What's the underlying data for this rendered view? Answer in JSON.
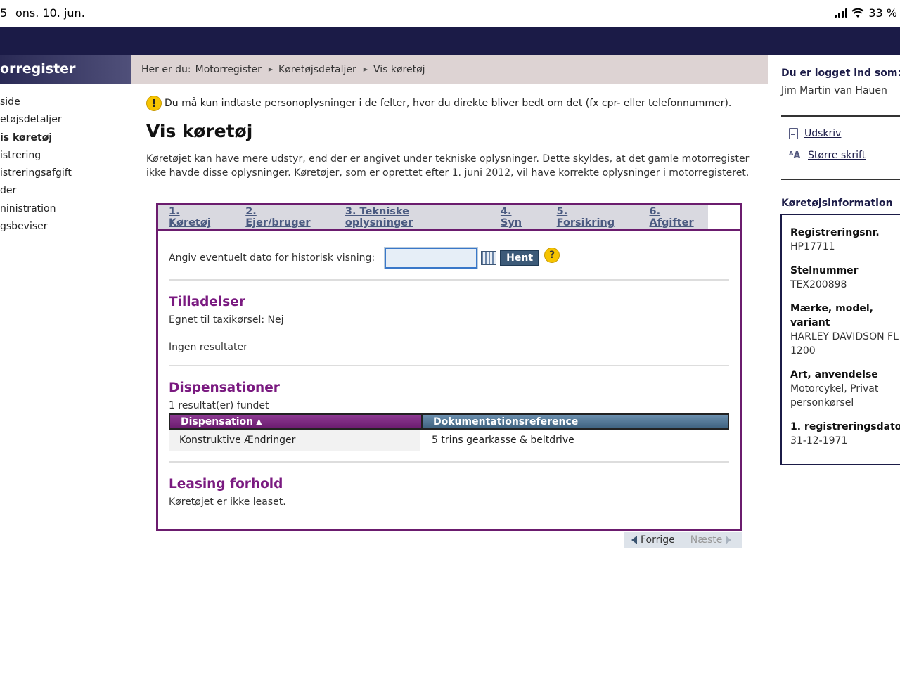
{
  "status": {
    "time": "5",
    "date": "ons. 10. jun.",
    "battery": "33 %"
  },
  "sidebar": {
    "title": "orregister",
    "items": [
      {
        "label": "side",
        "active": false
      },
      {
        "label": "etøjsdetaljer",
        "active": false
      },
      {
        "label": "is køretøj",
        "active": true
      },
      {
        "label": "istrering",
        "active": false
      },
      {
        "label": "istreringsafgift",
        "active": false
      },
      {
        "label": "der",
        "active": false
      },
      {
        "label": "ninistration",
        "active": false
      },
      {
        "label": "gsbeviser",
        "active": false
      }
    ]
  },
  "breadcrumb": {
    "prefix": "Her er du:",
    "items": [
      "Motorregister",
      "Køretøjsdetaljer",
      "Vis køretøj"
    ]
  },
  "notice": "Du må kun indtaste personoplysninger i de felter, hvor du direkte bliver bedt om det (fx cpr- eller telefonnummer).",
  "page_title": "Vis køretøj",
  "intro": "Køretøjet kan have mere udstyr, end der er angivet under tekniske oplysninger. Dette skyldes, at det gamle motorregister ikke havde disse oplysninger. Køretøjer, som er oprettet efter 1. juni 2012, vil have korrekte oplysninger i motorregisteret.",
  "tabs": [
    "1. Køretøj",
    "2. Ejer/bruger",
    "3. Tekniske oplysninger",
    "4. Syn",
    "5. Forsikring",
    "6. Afgifter"
  ],
  "history": {
    "label": "Angiv eventuelt dato for historisk visning:",
    "value": "",
    "button": "Hent",
    "help": "?"
  },
  "tilladelser": {
    "title": "Tilladelser",
    "taxi": "Egnet til taxikørsel: Nej",
    "result": "Ingen resultater"
  },
  "dispensationer": {
    "title": "Dispensationer",
    "count": "1 resultat(er) fundet",
    "columns": [
      "Dispensation",
      "Dokumentationsreference"
    ],
    "rows": [
      [
        "Konstruktive Ændringer",
        "5 trins gearkasse & beltdrive"
      ]
    ]
  },
  "leasing": {
    "title": "Leasing forhold",
    "text": "Køretøjet er ikke leaset."
  },
  "pager": {
    "prev": "Forrige",
    "next": "Næste"
  },
  "right": {
    "logged_in_label": "Du er logget ind som:",
    "user": "Jim Martin van Hauen",
    "print": "Udskriv",
    "bigger_text": "Større skrift",
    "info_title": "Køretøjsinformation",
    "info": [
      {
        "label": "Registreringsnr.",
        "value": "HP17711"
      },
      {
        "label": "Stelnummer",
        "value": "TEX200898"
      },
      {
        "label": "Mærke, model, variant",
        "value": "HARLEY DAVIDSON FL 1200"
      },
      {
        "label": "Art, anvendelse",
        "value": "Motorcykel, Privat personkørsel"
      },
      {
        "label": "1. registreringsdato",
        "value": "31-12-1971"
      }
    ]
  }
}
